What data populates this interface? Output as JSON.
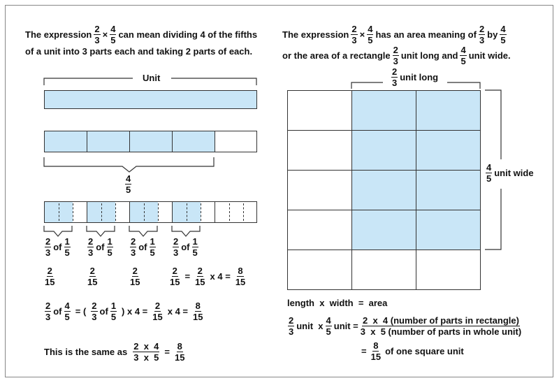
{
  "left": {
    "intro": {
      "pre": "The expression",
      "f1": {
        "n": "2",
        "d": "3"
      },
      "op": "×",
      "f2": {
        "n": "4",
        "d": "5"
      },
      "post": "can mean dividing 4 of the fifths",
      "line2": "of a unit into 3 parts each and taking 2 parts of each."
    },
    "unit_label": "Unit",
    "four_fifths": {
      "n": "4",
      "d": "5"
    },
    "part_labels": [
      {
        "a": {
          "n": "2",
          "d": "3"
        },
        "of": "of",
        "b": {
          "n": "1",
          "d": "5"
        }
      },
      {
        "a": {
          "n": "2",
          "d": "3"
        },
        "of": "of",
        "b": {
          "n": "1",
          "d": "5"
        }
      },
      {
        "a": {
          "n": "2",
          "d": "3"
        },
        "of": "of",
        "b": {
          "n": "1",
          "d": "5"
        }
      },
      {
        "a": {
          "n": "2",
          "d": "3"
        },
        "of": "of",
        "b": {
          "n": "1",
          "d": "5"
        }
      }
    ],
    "part_values": [
      {
        "n": "2",
        "d": "15"
      },
      {
        "n": "2",
        "d": "15"
      },
      {
        "n": "2",
        "d": "15"
      }
    ],
    "sum_eq": {
      "f1": {
        "n": "2",
        "d": "15"
      },
      "eq": "=",
      "f2": {
        "n": "2",
        "d": "15"
      },
      "times": "x 4 =",
      "f3": {
        "n": "8",
        "d": "15"
      }
    },
    "eq2": {
      "a": {
        "n": "2",
        "d": "3"
      },
      "of": "of",
      "b": {
        "n": "4",
        "d": "5"
      },
      "eq1": "= (",
      "c": {
        "n": "2",
        "d": "3"
      },
      "of2": "of",
      "d": {
        "n": "1",
        "d": "5"
      },
      "mid": ") x 4 =",
      "e": {
        "n": "2",
        "d": "15"
      },
      "times": "x 4 =",
      "f": {
        "n": "8",
        "d": "15"
      }
    },
    "same": {
      "text": "This is the same as",
      "f1": {
        "n": "2  x  4",
        "d": "3  x  5"
      },
      "eq": "=",
      "f2": {
        "n": "8",
        "d": "15"
      }
    }
  },
  "right": {
    "intro": {
      "pre": "The expression",
      "f1": {
        "n": "2",
        "d": "3"
      },
      "op": "×",
      "f2": {
        "n": "4",
        "d": "5"
      },
      "mid": "has an area meaning of",
      "f3": {
        "n": "2",
        "d": "3"
      },
      "by": "by",
      "f4": {
        "n": "4",
        "d": "5"
      },
      "l2a": "or the area of a rectangle",
      "f5": {
        "n": "2",
        "d": "3"
      },
      "l2b": "unit long and",
      "f6": {
        "n": "4",
        "d": "5"
      },
      "l2c": "unit wide."
    },
    "long_label": {
      "f": {
        "n": "2",
        "d": "3"
      },
      "text": "unit long"
    },
    "wide_label": {
      "f": {
        "n": "4",
        "d": "5"
      },
      "text": "unit wide"
    },
    "eq1": "length  x  width  =  area",
    "eq2": {
      "f1": {
        "n": "2",
        "d": "3"
      },
      "t1": "unit  x",
      "f2": {
        "n": "4",
        "d": "5"
      },
      "t2": "unit =",
      "f3": {
        "n": "2  x  4 (number of parts in rectangle)",
        "d": "3  x  5 (number of parts in whole unit)"
      }
    },
    "eq3": {
      "eq": "=",
      "f": {
        "n": "8",
        "d": "15"
      },
      "text": "of one square unit"
    }
  },
  "colors": {
    "shade": "#c9e6f7",
    "line": "#333333"
  }
}
